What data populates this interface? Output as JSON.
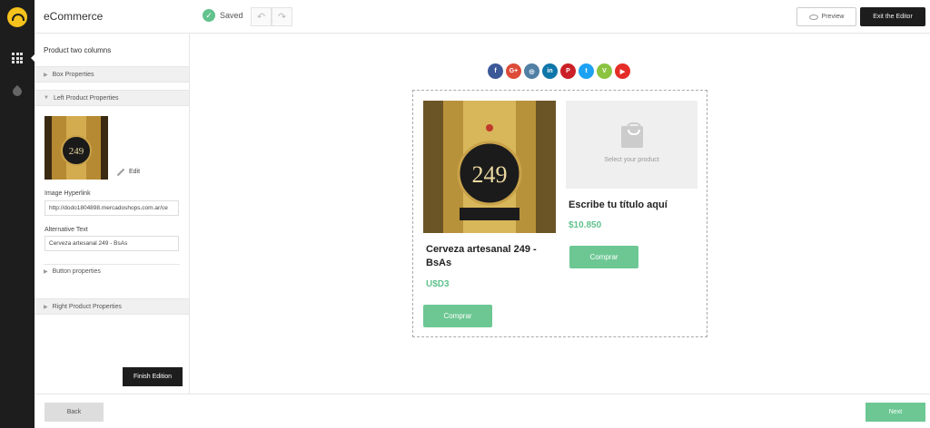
{
  "topbar": {
    "app_title": "eCommerce",
    "saved_label": "Saved",
    "preview_label": "Preview",
    "exit_label": "Exit the Editor"
  },
  "panel": {
    "title": "Product two columns",
    "box_properties": "Box Properties",
    "left_product_properties": "Left Product Properties",
    "edit_label": "Edit",
    "image_hyperlink_label": "Image Hyperlink",
    "image_hyperlink_value": "http://dodo1804898.mercadoshops.com.ar/ce",
    "alt_text_label": "Alternative Text",
    "alt_text_value": "Cerveza artesanal 249 - BsAs",
    "button_properties": "Button properties",
    "right_product_properties": "Right Product Properties",
    "finish_label": "Finish Edition"
  },
  "bottombar": {
    "back_label": "Back",
    "next_label": "Next"
  },
  "socials": [
    {
      "name": "facebook-icon",
      "glyph": "f",
      "color": "#3b5998"
    },
    {
      "name": "google-plus-icon",
      "glyph": "G+",
      "color": "#dd4b39"
    },
    {
      "name": "instagram-icon",
      "glyph": "◎",
      "color": "#517fa4"
    },
    {
      "name": "linkedin-icon",
      "glyph": "in",
      "color": "#0e76a8"
    },
    {
      "name": "pinterest-icon",
      "glyph": "P",
      "color": "#cb2027"
    },
    {
      "name": "twitter-icon",
      "glyph": "t",
      "color": "#1da1f2"
    },
    {
      "name": "vine-icon",
      "glyph": "V",
      "color": "#8ac440"
    },
    {
      "name": "youtube-icon",
      "glyph": "▶",
      "color": "#e52d27"
    }
  ],
  "left_product": {
    "title": "Cerveza artesanal 249 - BsAs",
    "price": "U$D3",
    "button": "Comprar"
  },
  "right_product": {
    "placeholder": "Select your product",
    "title": "Escribe tu título aquí",
    "price": "$10.850",
    "button": "Comprar"
  },
  "colors": {
    "accent": "#6cc793",
    "dark": "#1d1d1d"
  }
}
